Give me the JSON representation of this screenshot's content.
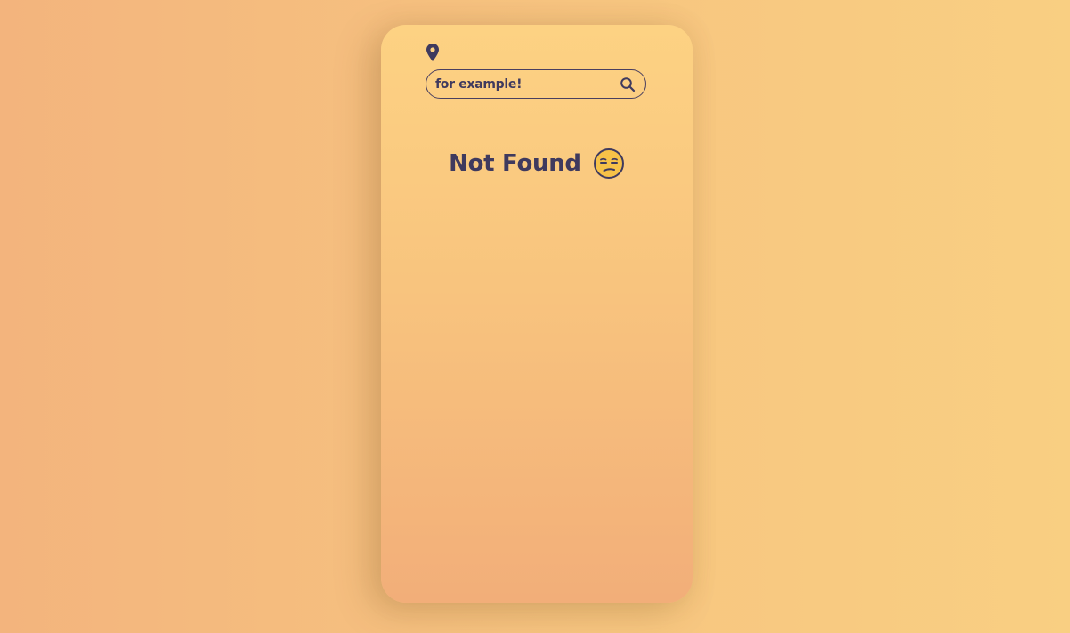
{
  "search": {
    "value": "for example!",
    "icon": "search-icon"
  },
  "header": {
    "location_icon": "map-pin-icon"
  },
  "result": {
    "message": "Not Found",
    "emoji_icon": "unamused-face-icon"
  },
  "colors": {
    "background": "#f6bf7f",
    "card_top": "#fdd283",
    "card_bottom": "#f2ae79",
    "text": "#3f3a5e"
  }
}
